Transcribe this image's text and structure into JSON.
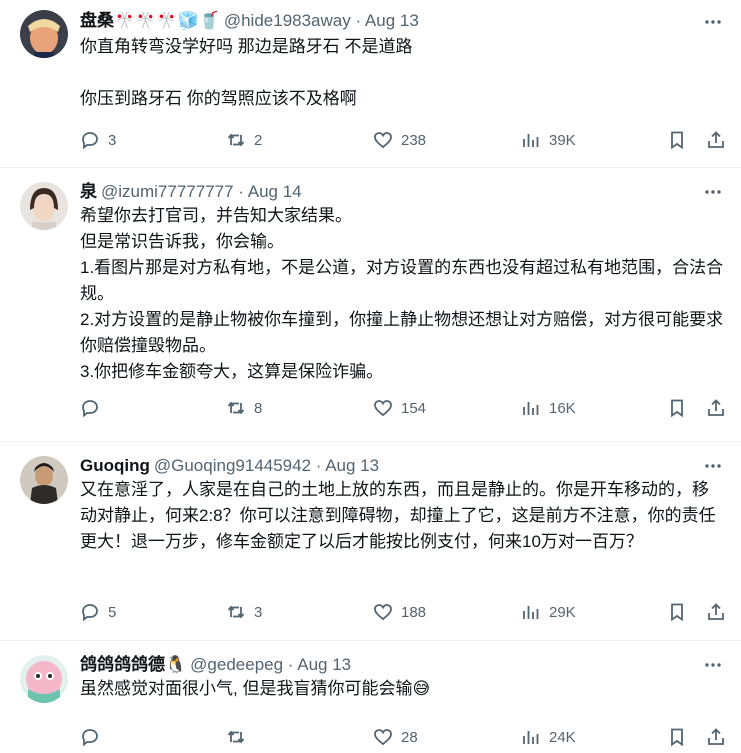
{
  "tweets": [
    {
      "name": "盘桑🎌🎌🎌🧊🥤",
      "meta": "@hide1983away · Aug 13",
      "text": "你直角转弯没学好吗 那边是路牙石 不是道路\n\n你压到路牙石 你的驾照应该不及格啊",
      "replies": "3",
      "retweets": "2",
      "likes": "238",
      "views": "39K"
    },
    {
      "name": "泉",
      "meta": "@izumi77777777 · Aug 14",
      "text": "希望你去打官司，并告知大家结果。\n但是常识告诉我，你会输。\n1.看图片那是对方私有地，不是公道，对方设置的东西也没有超过私有地范围，合法合规。\n2.对方设置的是静止物被你车撞到，你撞上静止物想还想让对方赔偿，对方很可能要求你赔偿撞毁物品。\n3.你把修车金额夸大，这算是保险诈骗。",
      "replies": "",
      "retweets": "8",
      "likes": "154",
      "views": "16K"
    },
    {
      "name": "Guoqing",
      "meta": "@Guoqing91445942 · Aug 13",
      "text": "又在意淫了，人家是在自己的土地上放的东西，而且是静止的。你是开车移动的，移动对静止，何来2:8？你可以注意到障碍物，却撞上了它，这是前方不注意，你的责任更大！退一万步，修车金额定了以后才能按比例支付，何来10万对一百万？",
      "replies": "5",
      "retweets": "3",
      "likes": "188",
      "views": "29K"
    },
    {
      "name": "鸽鸽鸽鸽德🐧",
      "meta": "@gedeepeg · Aug 13",
      "text": "虽然感觉对面很小气, 但是我盲猜你可能会输😅",
      "replies": "",
      "retweets": "",
      "likes": "28",
      "views": "24K"
    }
  ]
}
